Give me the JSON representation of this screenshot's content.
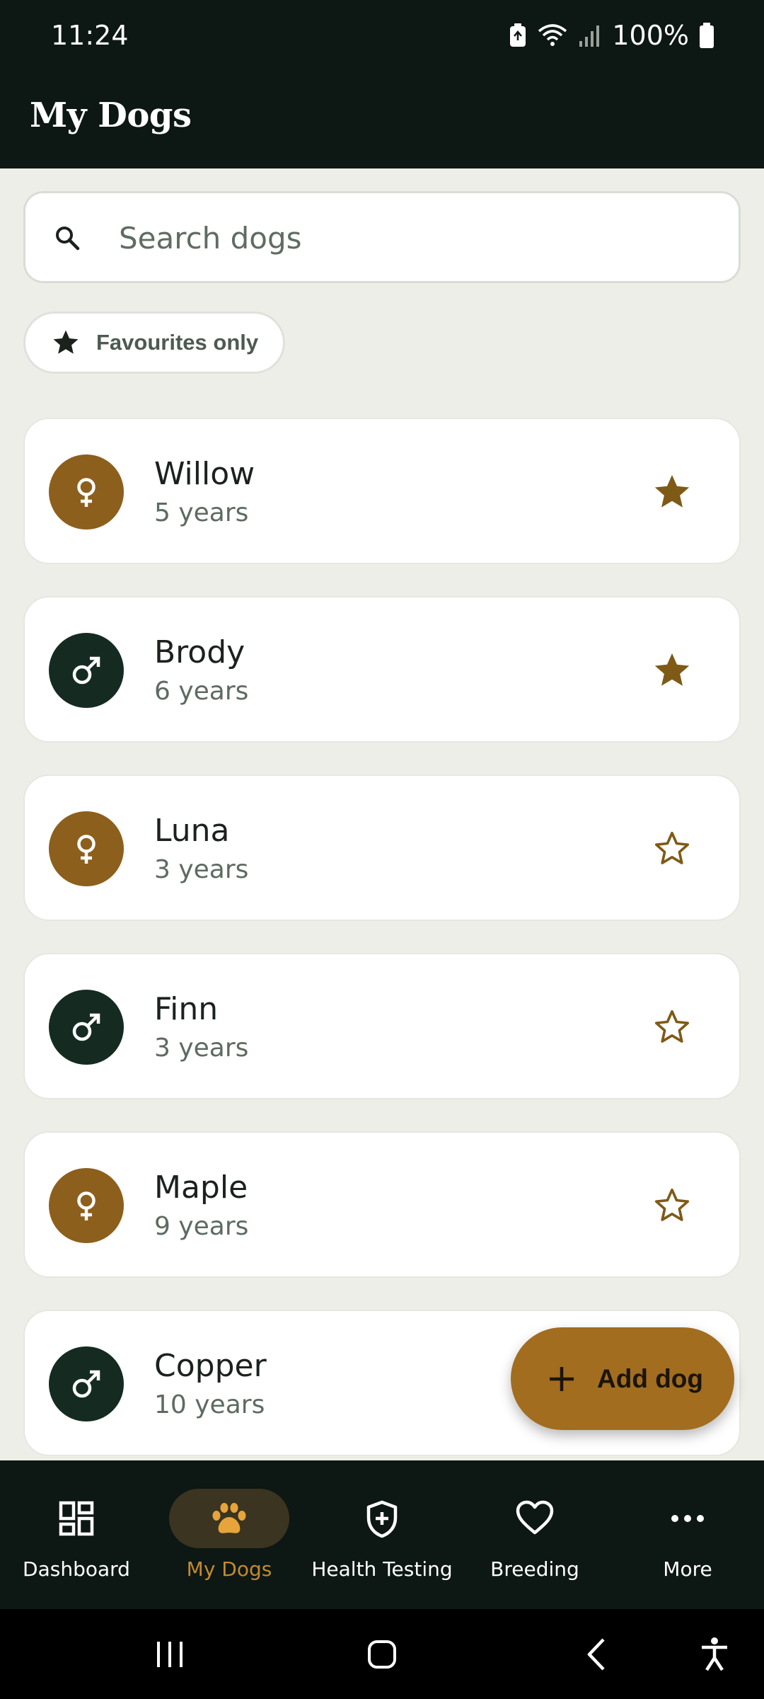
{
  "status_bar": {
    "time": "11:24",
    "battery": "100%"
  },
  "header": {
    "title": "My Dogs"
  },
  "search": {
    "placeholder": "Search dogs"
  },
  "filter": {
    "label": "Favourites only"
  },
  "dogs": [
    {
      "name": "Willow",
      "age": "5 years",
      "sex": "female",
      "favourite": true
    },
    {
      "name": "Brody",
      "age": "6 years",
      "sex": "male",
      "favourite": true
    },
    {
      "name": "Luna",
      "age": "3 years",
      "sex": "female",
      "favourite": false
    },
    {
      "name": "Finn",
      "age": "3 years",
      "sex": "male",
      "favourite": false
    },
    {
      "name": "Maple",
      "age": "9 years",
      "sex": "female",
      "favourite": false
    },
    {
      "name": "Copper",
      "age": "10 years",
      "sex": "male",
      "favourite": false
    }
  ],
  "fab": {
    "label": "Add dog",
    "icon": "plus-icon"
  },
  "nav": {
    "items": [
      {
        "label": "Dashboard",
        "icon": "dashboard-icon"
      },
      {
        "label": "My Dogs",
        "icon": "paw-icon",
        "active": true
      },
      {
        "label": "Health Testing",
        "icon": "shield-plus-icon"
      },
      {
        "label": "Breeding",
        "icon": "heart-icon"
      },
      {
        "label": "More",
        "icon": "more-horizontal-icon"
      }
    ]
  },
  "colors": {
    "header_bg": "#0d1714",
    "female_accent": "#8d5f1c",
    "male_accent": "#152b22",
    "star": "#7f5a16",
    "fab_bg": "#a26d1f",
    "active_nav": "#c48a2e",
    "page_bg": "#eeeee8"
  }
}
